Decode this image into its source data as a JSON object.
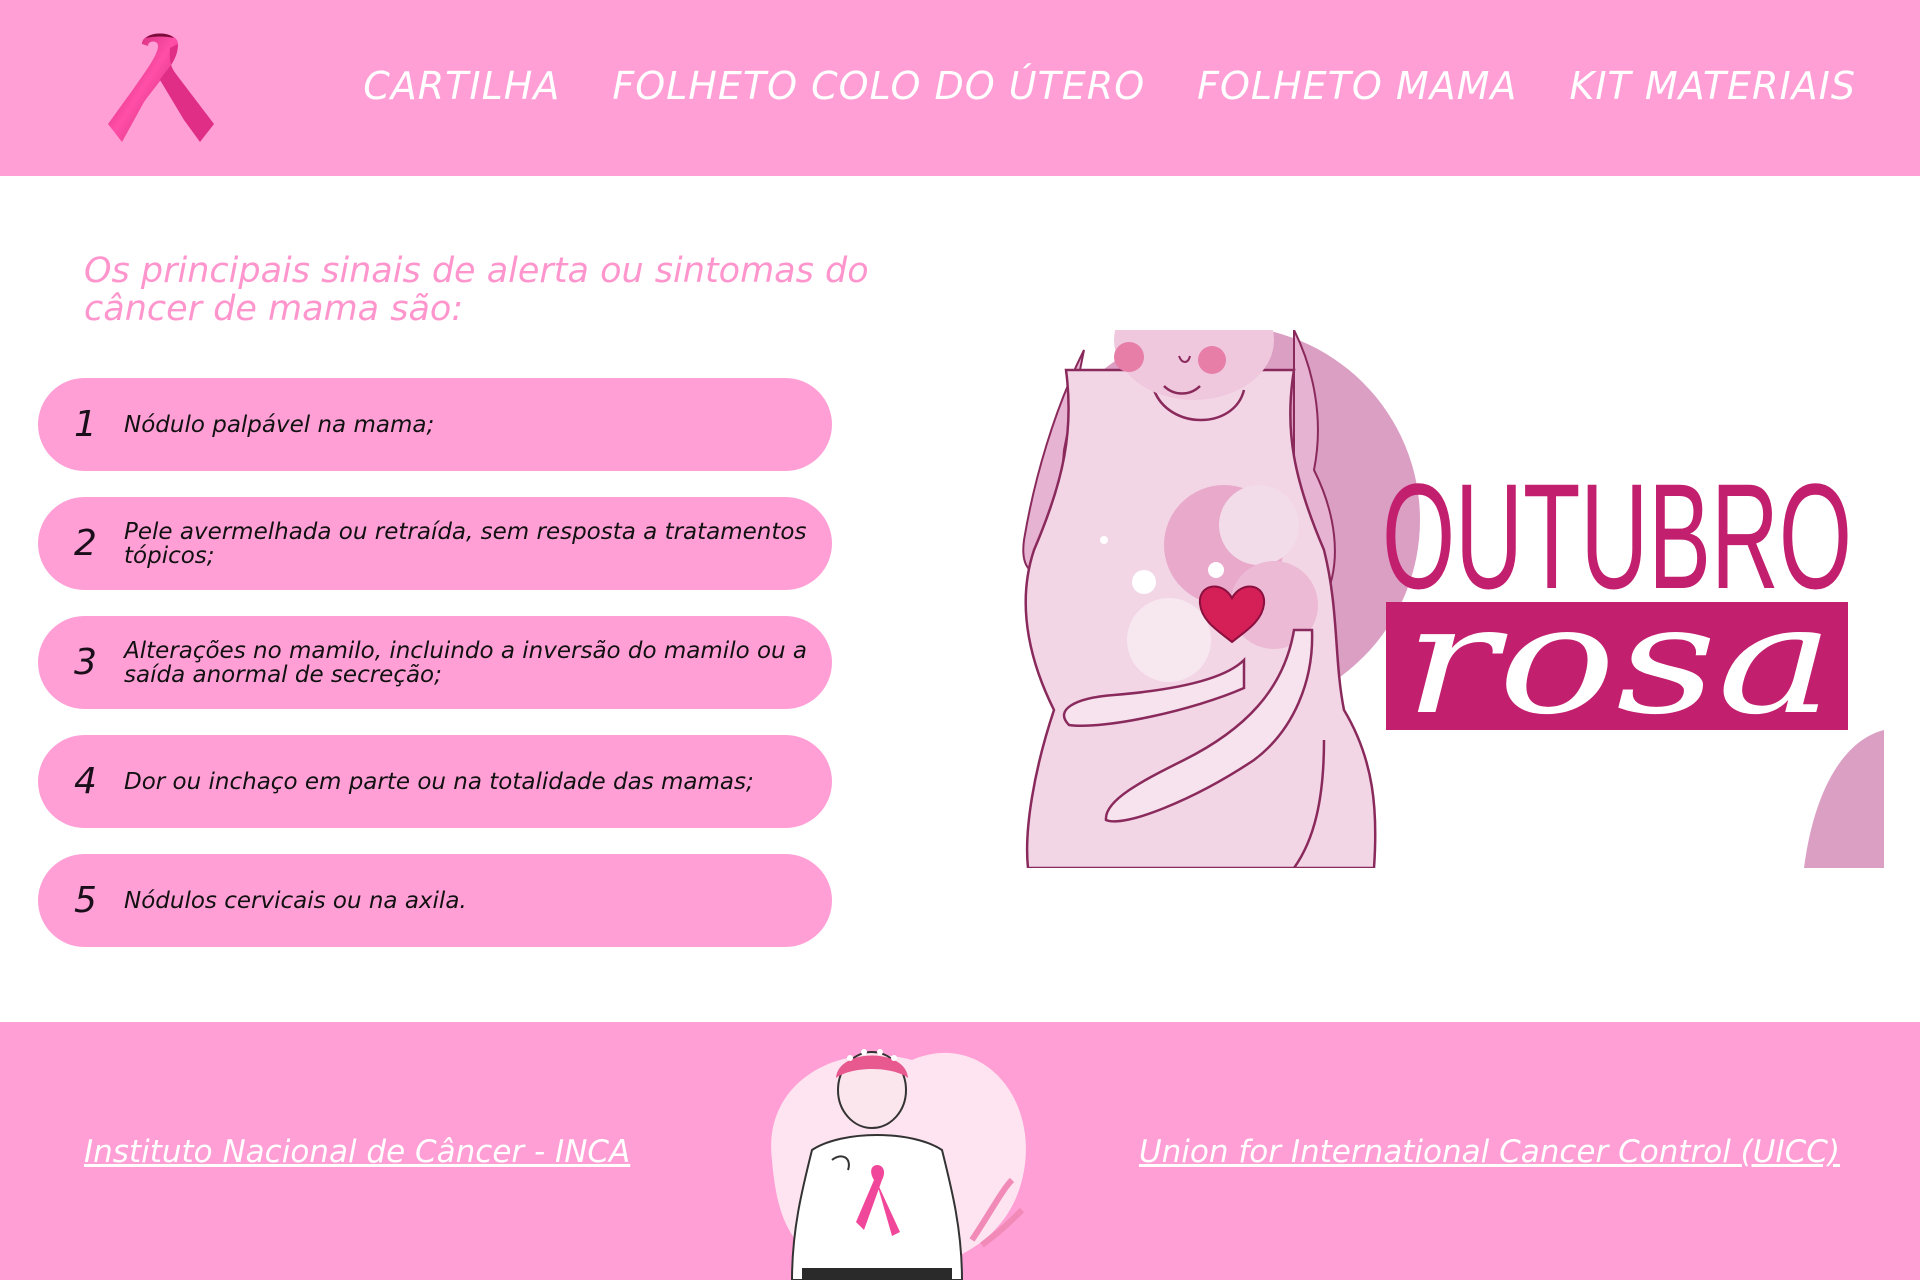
{
  "nav": {
    "items": [
      {
        "label": "CARTILHA"
      },
      {
        "label": "FOLHETO COLO DO ÚTERO"
      },
      {
        "label": "FOLHETO MAMA"
      },
      {
        "label": "KIT MATERIAIS"
      }
    ]
  },
  "main": {
    "heading": "Os principais sinais de alerta ou sintomas do câncer de mama são:",
    "symptoms": [
      {
        "number": "1",
        "text": "Nódulo palpável na mama;"
      },
      {
        "number": "2",
        "text": "Pele avermelhada ou retraída, sem resposta a tratamentos tópicos;"
      },
      {
        "number": "3",
        "text": "Alterações no mamilo, incluindo a inversão do mamilo ou a saída anormal de secreção;"
      },
      {
        "number": "4",
        "text": "Dor ou inchaço em parte ou na totalidade das mamas;"
      },
      {
        "number": "5",
        "text": "Nódulos cervicais ou na axila."
      }
    ]
  },
  "hero": {
    "title_word1": "OUTUBRO",
    "title_word2": "rosa"
  },
  "footer": {
    "left_link": "Instituto Nacional de Câncer - INCA",
    "right_link": "Union for International Cancer Control (UICC)"
  },
  "colors": {
    "brand_pink": "#ff9fd6",
    "heading_pink": "#ff95cd",
    "magenta": "#c2206e",
    "illustration_mauve": "#dc9fc4"
  },
  "icons": {
    "logo": "pink-ribbon-icon",
    "heart": "heart-icon"
  }
}
